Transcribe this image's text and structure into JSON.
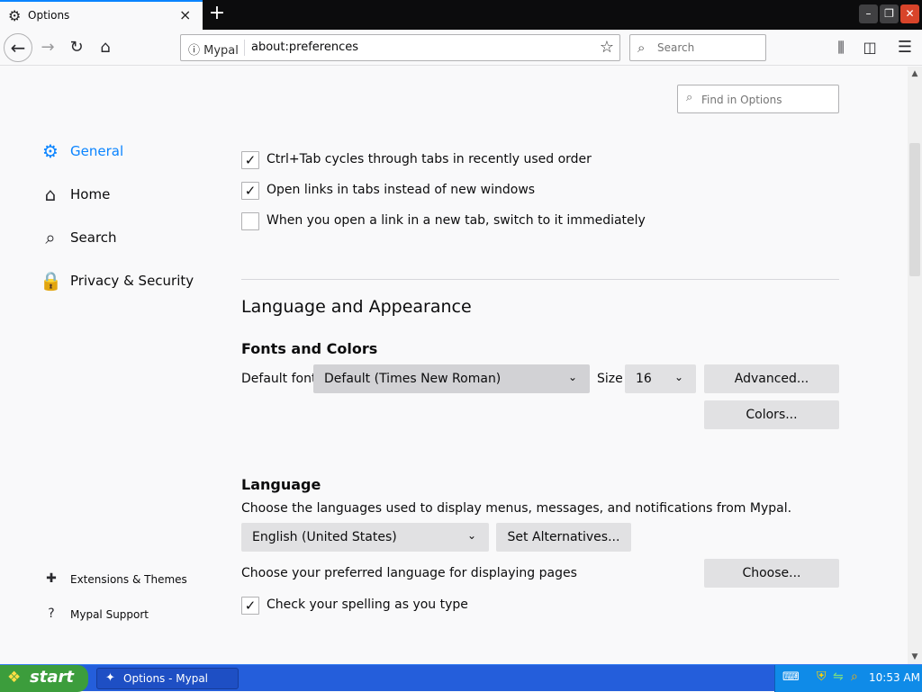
{
  "browser": {
    "tab": {
      "title": "Options",
      "icon": "gear-icon",
      "close": "×"
    },
    "newtab_label": "+",
    "window_controls": {
      "minimize": "–",
      "maximize": "❐",
      "close": "✕"
    },
    "nav": {
      "back": "←",
      "forward": "→",
      "reload": "↻",
      "home": "⌂",
      "site_identity": "ⓘ Mypal",
      "url": "about:preferences",
      "bookmark_star": "☆",
      "search_placeholder": "Search",
      "search_icon": "⌕",
      "library": "⫼",
      "sidebar_toggle": "◫",
      "menu": "☰"
    }
  },
  "preferences": {
    "find": {
      "placeholder": "Find in Options",
      "icon": "⌕"
    },
    "categories": [
      {
        "label": "General",
        "icon": "⚙",
        "selected": true
      },
      {
        "label": "Home",
        "icon": "⌂",
        "selected": false
      },
      {
        "label": "Search",
        "icon": "⌕",
        "selected": false
      },
      {
        "label": "Privacy & Security",
        "icon": "🔒",
        "selected": false
      }
    ],
    "footer_links": [
      {
        "label": "Extensions & Themes",
        "icon": "✚"
      },
      {
        "label": "Mypal Support",
        "icon": "?"
      }
    ],
    "tabs_options": [
      {
        "label": "Ctrl+Tab cycles through tabs in recently used order",
        "checked": true
      },
      {
        "label": "Open links in tabs instead of new windows",
        "checked": true
      },
      {
        "label": "When you open a link in a new tab, switch to it immediately",
        "checked": false
      }
    ],
    "language_appearance": {
      "heading": "Language and Appearance",
      "fonts_heading": "Fonts and Colors",
      "default_font_label": "Default font",
      "default_font_value": "Default (Times New Roman)",
      "size_label": "Size",
      "size_value": "16",
      "advanced_button": "Advanced...",
      "colors_button": "Colors...",
      "language_heading": "Language",
      "language_desc": "Choose the languages used to display menus, messages, and notifications from Mypal.",
      "language_value": "English (United States)",
      "set_alternatives_button": "Set Alternatives...",
      "pref_lang_desc": "Choose your preferred language for displaying pages",
      "choose_button": "Choose...",
      "spell_check_label": "Check your spelling as you type",
      "spell_check_checked": true
    },
    "checkmark": "✓",
    "dropdown_arrow": "⌄"
  },
  "taskbar": {
    "start_label": "start",
    "start_logo": "❖",
    "task_label": "Options - Mypal",
    "task_icon": "✦",
    "tray": {
      "kbd": "⌨",
      "shield": "⛨",
      "net": "⇋",
      "search": "⌕",
      "time": "10:53 AM"
    }
  },
  "colors": {
    "accent": "#0a84ff",
    "taskbar": "#245edb",
    "start": "#3c9d3c",
    "tray": "#0f8be8"
  }
}
